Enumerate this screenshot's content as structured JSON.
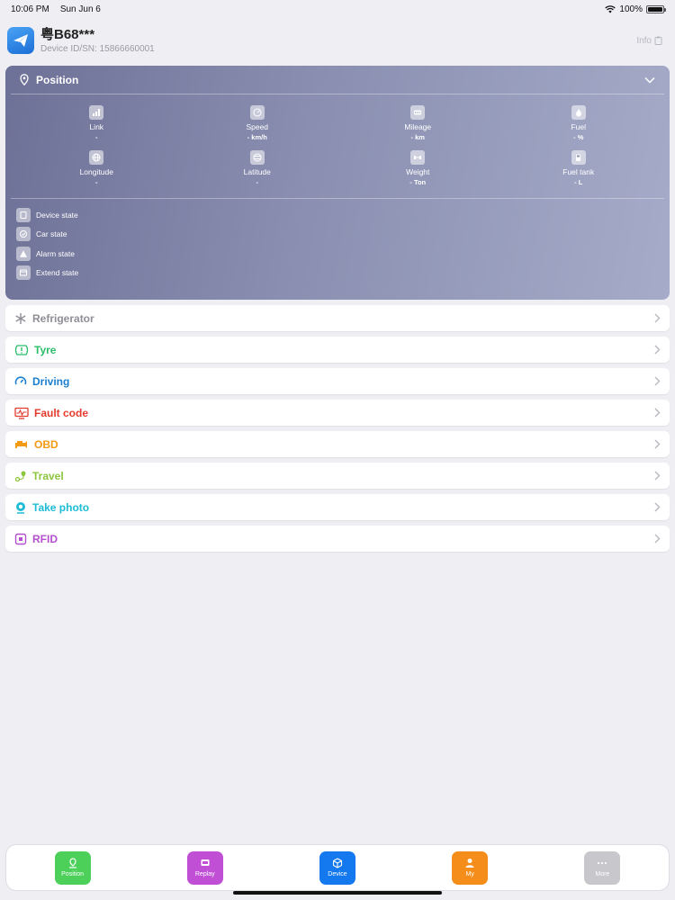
{
  "status": {
    "time": "10:06 PM",
    "date": "Sun Jun 6",
    "battery": "100%",
    "battery_level": 1.0
  },
  "header": {
    "device_name": "粤B68***",
    "device_id": "Device ID/SN: 15866660001",
    "info_label": "Info"
  },
  "position": {
    "title": "Position",
    "metrics": [
      {
        "label": "Link",
        "value": "-",
        "icon": "signal-icon"
      },
      {
        "label": "Speed",
        "value": "- km/h",
        "icon": "speedometer-icon"
      },
      {
        "label": "Mileage",
        "value": "- km",
        "icon": "road-icon"
      },
      {
        "label": "Fuel",
        "value": "- %",
        "icon": "flame-icon"
      },
      {
        "label": "Longitude",
        "value": "-",
        "icon": "globe-icon"
      },
      {
        "label": "Latitude",
        "value": "-",
        "icon": "compass-icon"
      },
      {
        "label": "Weight",
        "value": "- Ton",
        "icon": "dumbbell-icon"
      },
      {
        "label": "Fuel tank",
        "value": "- L",
        "icon": "fuel-tank-icon"
      }
    ],
    "states": [
      {
        "label": "Device state",
        "icon": "device-icon"
      },
      {
        "label": "Car state",
        "icon": "car-state-icon"
      },
      {
        "label": "Alarm state",
        "icon": "warning-icon"
      },
      {
        "label": "Extend state",
        "icon": "extend-icon"
      }
    ]
  },
  "menu": [
    {
      "label": "Refrigerator",
      "color": "#8e8e96",
      "icon": "snowflake-icon"
    },
    {
      "label": "Tyre",
      "color": "#2bbf6a",
      "icon": "tyre-icon"
    },
    {
      "label": "Driving",
      "color": "#1a7fd0",
      "icon": "steering-icon"
    },
    {
      "label": "Fault code",
      "color": "#e53b2f",
      "icon": "monitor-fault-icon"
    },
    {
      "label": "OBD",
      "color": "#f39a14",
      "icon": "engine-icon"
    },
    {
      "label": "Travel",
      "color": "#8cc63f",
      "icon": "route-icon"
    },
    {
      "label": "Take photo",
      "color": "#1bbcd4",
      "icon": "camera-icon"
    },
    {
      "label": "RFID",
      "color": "#b44fcf",
      "icon": "rfid-icon"
    }
  ],
  "tabs": [
    {
      "label": "Position",
      "color": "#4cd05a"
    },
    {
      "label": "Replay",
      "color": "#c04fd6"
    },
    {
      "label": "Device",
      "color": "#1479ef"
    },
    {
      "label": "My",
      "color": "#f58d1a"
    },
    {
      "label": "More",
      "color": "#c7c7cc"
    }
  ]
}
